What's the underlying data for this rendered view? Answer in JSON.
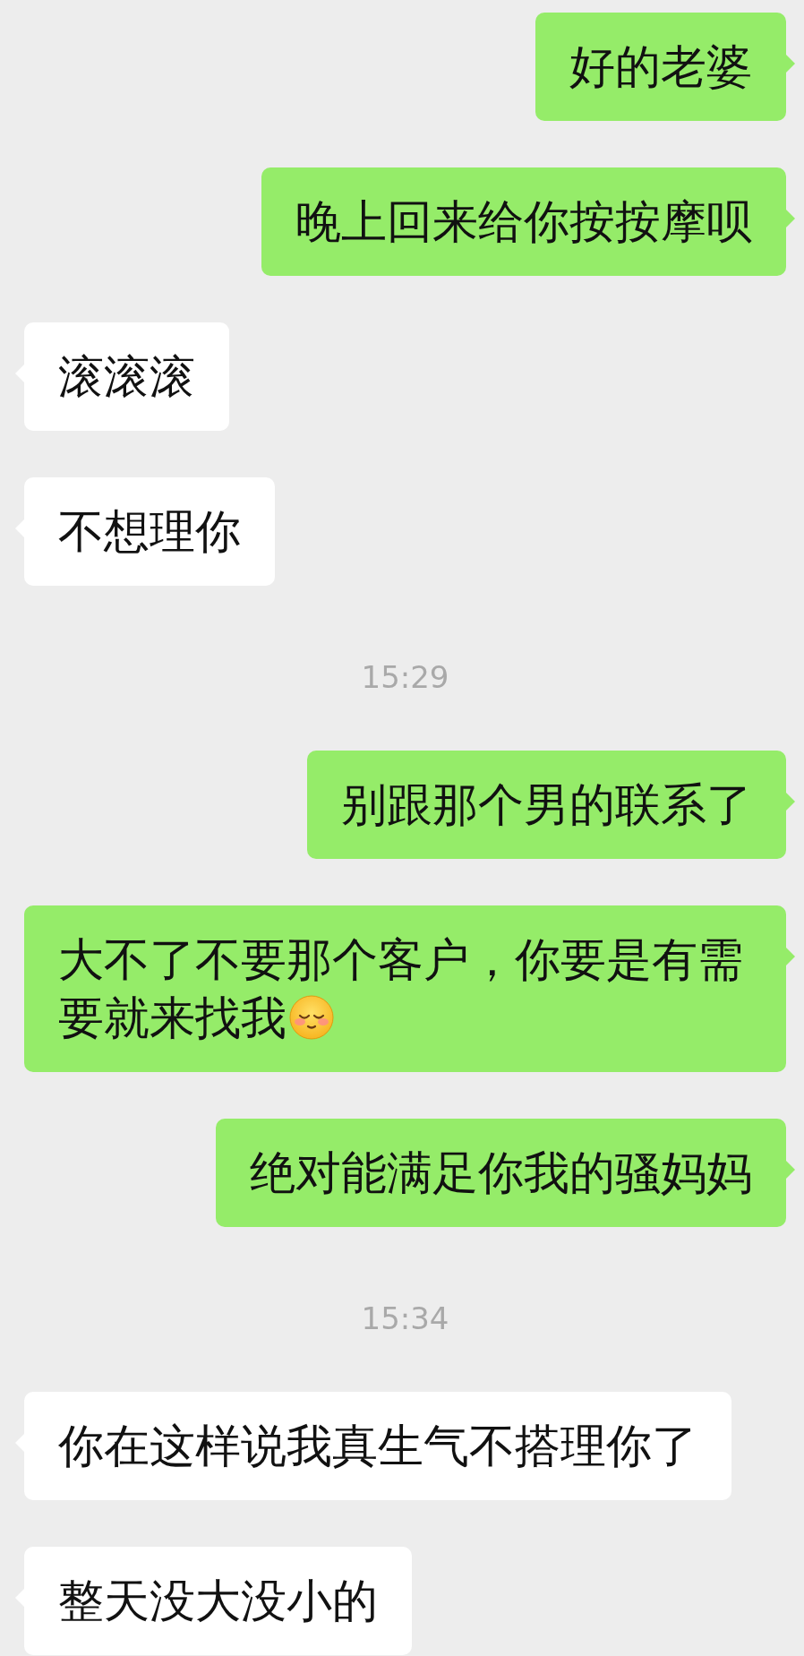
{
  "messages": [
    {
      "kind": "message",
      "outgoing": true,
      "text": "好的老婆"
    },
    {
      "kind": "message",
      "outgoing": true,
      "text": "晚上回来给你按按摩呗"
    },
    {
      "kind": "message",
      "outgoing": false,
      "text": "滚滚滚"
    },
    {
      "kind": "message",
      "outgoing": false,
      "text": "不想理你"
    },
    {
      "kind": "time",
      "text": "15:29"
    },
    {
      "kind": "message",
      "outgoing": true,
      "text": "别跟那个男的联系了"
    },
    {
      "kind": "message",
      "outgoing": true,
      "text": "大不了不要那个客户，你要是有需要就来找我",
      "emoji": true
    },
    {
      "kind": "message",
      "outgoing": true,
      "text": "绝对能满足你我的骚妈妈"
    },
    {
      "kind": "time",
      "text": "15:34"
    },
    {
      "kind": "message",
      "outgoing": false,
      "text": "你在这样说我真生气不搭理你了"
    },
    {
      "kind": "message",
      "outgoing": false,
      "text": "整天没大没小的"
    }
  ]
}
